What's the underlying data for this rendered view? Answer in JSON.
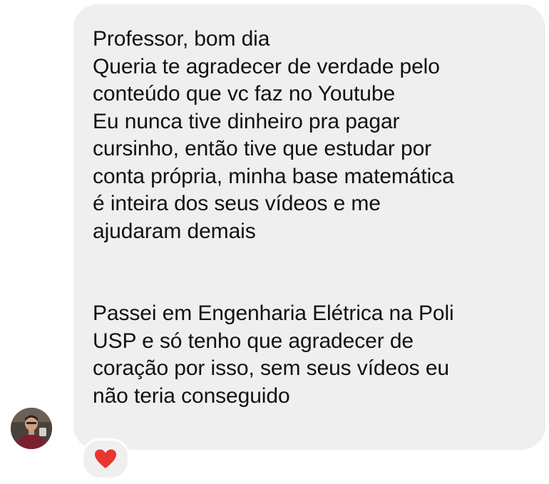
{
  "message": {
    "lines": [
      "Professor, bom dia",
      "Queria te agradecer de verdade pelo",
      "conteúdo que vc faz no Youtube",
      "Eu nunca tive dinheiro pra pagar",
      "cursinho, então tive que estudar por",
      "conta própria, minha base matemática",
      "é inteira dos seus vídeos e me",
      "ajudaram demais",
      "Passei em Engenharia Elétrica na Poli",
      "USP e só tenho que agradecer de",
      "coração por isso, sem seus vídeos eu",
      "não teria conseguido"
    ]
  },
  "reaction": {
    "icon": "heart-icon",
    "color": "#e8352e"
  },
  "colors": {
    "bubble": "#efeff0",
    "text": "#111111",
    "background": "#ffffff"
  }
}
